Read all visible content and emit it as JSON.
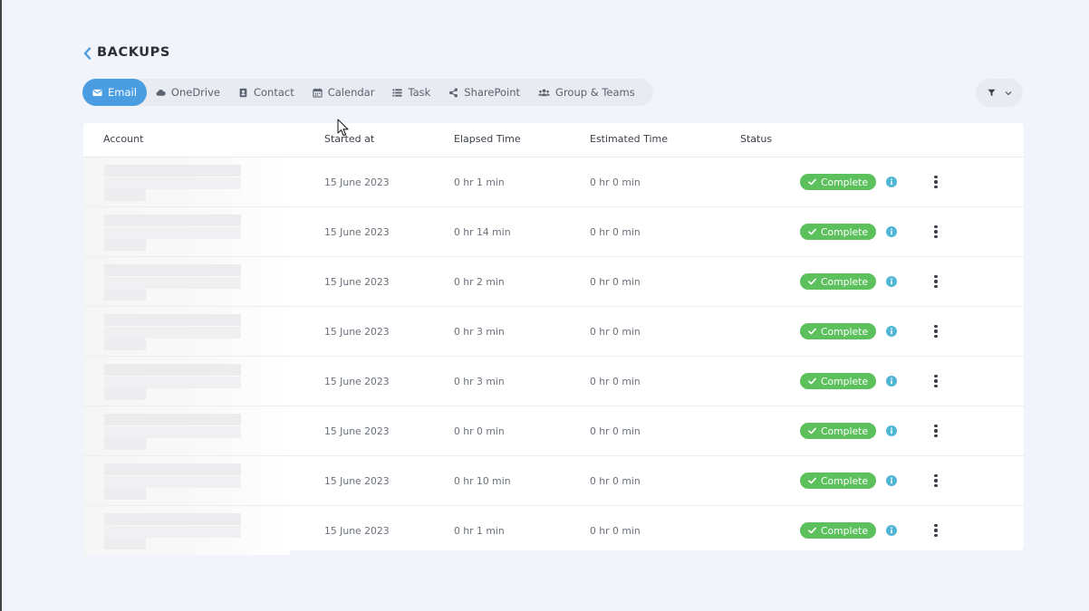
{
  "header": {
    "title": "BACKUPS"
  },
  "tabs": [
    {
      "label": "Email",
      "icon": "envelope-icon",
      "active": true
    },
    {
      "label": "OneDrive",
      "icon": "cloud-icon",
      "active": false
    },
    {
      "label": "Contact",
      "icon": "contact-card-icon",
      "active": false
    },
    {
      "label": "Calendar",
      "icon": "calendar-icon",
      "active": false
    },
    {
      "label": "Task",
      "icon": "list-icon",
      "active": false
    },
    {
      "label": "SharePoint",
      "icon": "share-icon",
      "active": false
    },
    {
      "label": "Group & Teams",
      "icon": "users-icon",
      "active": false
    }
  ],
  "filter": {
    "icon": "filter-icon"
  },
  "table": {
    "columns": {
      "account": "Account",
      "started": "Started at",
      "elapsed": "Elapsed Time",
      "estimated": "Estimated Time",
      "status": "Status"
    },
    "rows": [
      {
        "started": "15 June 2023",
        "elapsed": "0 hr 1 min",
        "estimated": "0 hr 0 min",
        "status": "Complete"
      },
      {
        "started": "15 June 2023",
        "elapsed": "0 hr 14 min",
        "estimated": "0 hr 0 min",
        "status": "Complete"
      },
      {
        "started": "15 June 2023",
        "elapsed": "0 hr 2 min",
        "estimated": "0 hr 0 min",
        "status": "Complete"
      },
      {
        "started": "15 June 2023",
        "elapsed": "0 hr 3 min",
        "estimated": "0 hr 0 min",
        "status": "Complete"
      },
      {
        "started": "15 June 2023",
        "elapsed": "0 hr 3 min",
        "estimated": "0 hr 0 min",
        "status": "Complete"
      },
      {
        "started": "15 June 2023",
        "elapsed": "0 hr 0 min",
        "estimated": "0 hr 0 min",
        "status": "Complete"
      },
      {
        "started": "15 June 2023",
        "elapsed": "0 hr 10 min",
        "estimated": "0 hr 0 min",
        "status": "Complete"
      },
      {
        "started": "15 June 2023",
        "elapsed": "0 hr 1 min",
        "estimated": "0 hr 0 min",
        "status": "Complete"
      }
    ]
  },
  "colors": {
    "accent": "#4a9de0",
    "success": "#5cc05c",
    "info": "#4fb6d6",
    "background": "#f1f4fb"
  }
}
